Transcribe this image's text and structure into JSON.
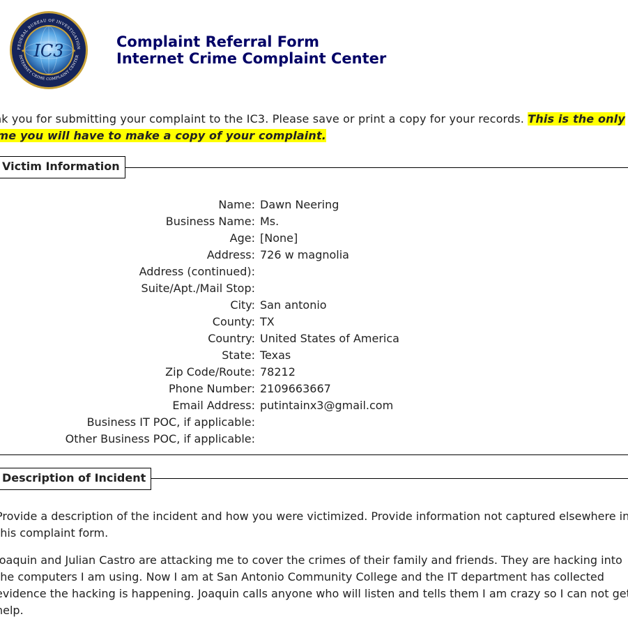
{
  "header": {
    "title_line1": "Complaint Referral Form",
    "title_line2": "Internet Crime Complaint Center",
    "seal": {
      "top_text": "FEDERAL BUREAU OF INVESTIGATION",
      "bottom_text": "INTERNET CRIME COMPLAINT CENTER",
      "center": "IC3"
    }
  },
  "notice": {
    "text": "ank you for submitting your complaint to the IC3. Please save or print a copy for your records.",
    "highlight": "This is the only time you will have to make a copy of your complaint."
  },
  "victim": {
    "legend": "Victim Information",
    "fields": [
      {
        "label": "Name:",
        "value": "Dawn Neering"
      },
      {
        "label": "Business Name:",
        "value": "Ms."
      },
      {
        "label": "Age:",
        "value": "[None]"
      },
      {
        "label": "Address:",
        "value": "726 w magnolia"
      },
      {
        "label": "Address (continued):",
        "value": ""
      },
      {
        "label": "Suite/Apt./Mail Stop:",
        "value": ""
      },
      {
        "label": "City:",
        "value": "San antonio"
      },
      {
        "label": "County:",
        "value": "TX"
      },
      {
        "label": "Country:",
        "value": "United States of America"
      },
      {
        "label": "State:",
        "value": "Texas"
      },
      {
        "label": "Zip Code/Route:",
        "value": "78212"
      },
      {
        "label": "Phone Number:",
        "value": "2109663667"
      },
      {
        "label": "Email Address:",
        "value": "putintainx3@gmail.com"
      },
      {
        "label": "Business IT POC, if applicable:",
        "value": ""
      },
      {
        "label": "Other Business POC, if applicable:",
        "value": ""
      }
    ]
  },
  "incident": {
    "legend": "Description of Incident",
    "prompt": "Provide a description of the incident and how you were victimized. Provide information not captured elsewhere in this complaint form.",
    "description": "Joaquin and Julian Castro are attacking me to cover the crimes of their family and friends. They are hacking into the computers I am using. Now I am at San Antonio Community College and the IT department has collected evidence the hacking is happening. Joaquin calls anyone who will listen and tells them I am crazy so I can not get help."
  }
}
